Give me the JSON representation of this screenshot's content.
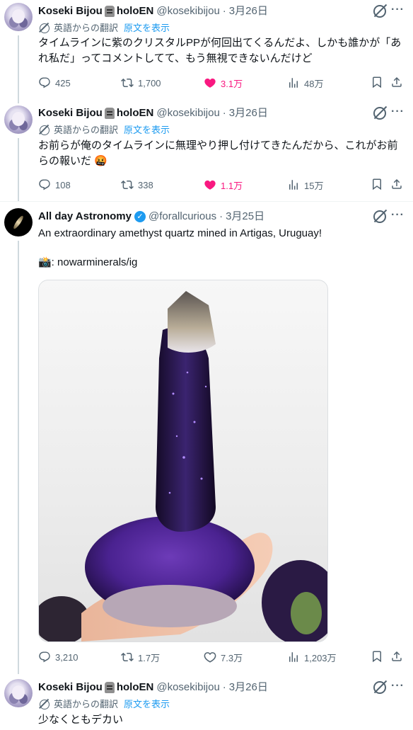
{
  "tweets": [
    {
      "name": "Koseki Bijou",
      "name_suffix": "holoEN",
      "handle": "@kosekibijou",
      "date": "3月26日",
      "translated_label": "英語からの翻訳",
      "show_original": "原文を表示",
      "text": "タイムラインに紫のクリスタルPPが何回出てくるんだよ、しかも誰かが「あれ私だ」ってコメントしてて、もう無視できないんだけど",
      "replies": "425",
      "reposts": "1,700",
      "likes": "3.1万",
      "views": "48万"
    },
    {
      "name": "Koseki Bijou",
      "name_suffix": "holoEN",
      "handle": "@kosekibijou",
      "date": "3月26日",
      "translated_label": "英語からの翻訳",
      "show_original": "原文を表示",
      "text": "お前らが俺のタイムラインに無理やり押し付けてきたんだから、これがお前らの報いだ 🤬",
      "replies": "108",
      "reposts": "338",
      "likes": "1.1万",
      "views": "15万"
    },
    {
      "name": "All day Astronomy",
      "handle": "@forallcurious",
      "date": "3月25日",
      "text": "An extraordinary amethyst quartz mined in Artigas, Uruguay!",
      "text2": "📸: nowarminerals/ig",
      "replies": "3,210",
      "reposts": "1.7万",
      "likes": "7.3万",
      "views": "1,203万"
    },
    {
      "name": "Koseki Bijou",
      "name_suffix": "holoEN",
      "handle": "@kosekibijou",
      "date": "3月26日",
      "translated_label": "英語からの翻訳",
      "show_original": "原文を表示",
      "text": "少なくともデカい"
    }
  ],
  "separator": "·",
  "colors": {
    "like": "#f91880",
    "link": "#1d9bf0",
    "muted": "#536471",
    "crystal": "#3a1f6e"
  }
}
